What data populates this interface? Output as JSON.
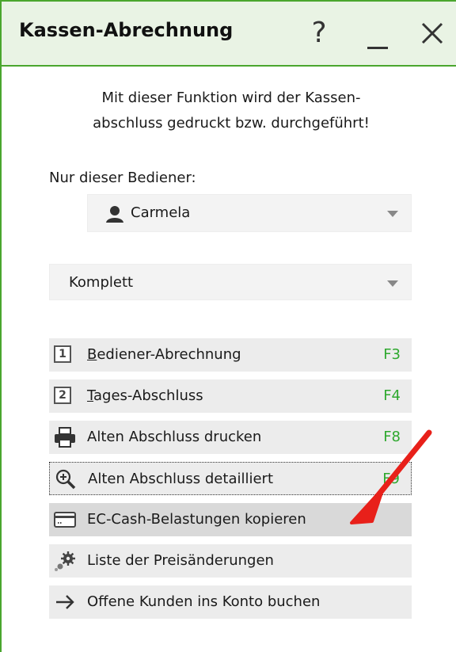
{
  "window": {
    "title": "Kassen-Abrechnung"
  },
  "titlebar": {
    "help": "?"
  },
  "intro": {
    "line1": "Mit dieser Funktion wird der Kassen-",
    "line2": "abschluss gedruckt bzw. durchgeführt!"
  },
  "operator": {
    "label": "Nur dieser Bediener:",
    "selected": "Carmela"
  },
  "mode": {
    "selected": "Komplett"
  },
  "actions": [
    {
      "icon": "number-1-icon",
      "number": "1",
      "label_u": "B",
      "label_rest": "ediener-Abrechnung",
      "key": "F3"
    },
    {
      "icon": "number-2-icon",
      "number": "2",
      "label_u": "T",
      "label_rest": "ages-Abschluss",
      "key": "F4"
    },
    {
      "icon": "printer-icon",
      "label": "Alten Abschluss drucken",
      "key": "F8"
    },
    {
      "icon": "magnifier-plus-icon",
      "label": "Alten Abschluss detailliert",
      "key": "F9"
    },
    {
      "icon": "credit-card-icon",
      "label": "EC-Cash-Belastungen kopieren"
    },
    {
      "icon": "gears-icon",
      "label": "Liste der Preisänderungen"
    },
    {
      "icon": "arrow-right-icon",
      "label": "Offene Kunden ins Konto buchen"
    }
  ],
  "annotation": {
    "icon": "red-arrow-icon",
    "color": "#e8201a"
  },
  "colors": {
    "accent": "#4aa62e",
    "shortcut": "#2ea82e",
    "titlebar_bg": "#e9f3e4"
  }
}
